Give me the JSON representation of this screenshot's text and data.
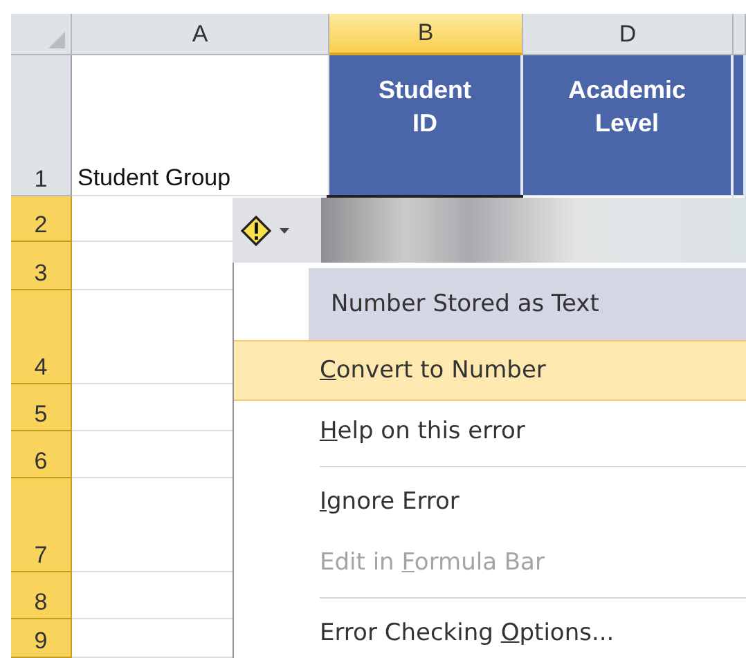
{
  "columns": [
    {
      "label": "A",
      "selected": false
    },
    {
      "label": "B",
      "selected": true
    },
    {
      "label": "D",
      "selected": false
    }
  ],
  "header_row": {
    "number": "1",
    "cells": [
      {
        "text": "Student Group",
        "kind": "plain"
      },
      {
        "text": "Student ID",
        "kind": "header"
      },
      {
        "text": "Academic Level",
        "kind": "header"
      }
    ]
  },
  "rows": [
    {
      "number": "2",
      "selected": true
    },
    {
      "number": "3",
      "selected": true
    },
    {
      "number": "4",
      "selected": true
    },
    {
      "number": "5",
      "selected": true
    },
    {
      "number": "6",
      "selected": true
    },
    {
      "number": "7",
      "selected": true
    },
    {
      "number": "8",
      "selected": true
    },
    {
      "number": "9",
      "selected": true
    }
  ],
  "error_menu": {
    "title": "Number Stored as Text",
    "items": [
      {
        "label_parts": [
          {
            "text": "C",
            "underlined": true
          },
          {
            "text": "onvert to Number",
            "underlined": false
          }
        ],
        "selected": true,
        "disabled": false,
        "separator_after": false
      },
      {
        "label_parts": [
          {
            "text": "H",
            "underlined": true
          },
          {
            "text": "elp on this error",
            "underlined": false
          }
        ],
        "selected": false,
        "disabled": false,
        "separator_after": true
      },
      {
        "label_parts": [
          {
            "text": "I",
            "underlined": true
          },
          {
            "text": "gnore Error",
            "underlined": false
          }
        ],
        "selected": false,
        "disabled": false,
        "separator_after": false
      },
      {
        "label_parts": [
          {
            "text": "Edit in ",
            "underlined": false
          },
          {
            "text": "F",
            "underlined": true
          },
          {
            "text": "ormula Bar",
            "underlined": false
          }
        ],
        "selected": false,
        "disabled": true,
        "separator_after": true
      },
      {
        "label_parts": [
          {
            "text": "Error Checking ",
            "underlined": false
          },
          {
            "text": "O",
            "underlined": true
          },
          {
            "text": "ptions...",
            "underlined": false
          }
        ],
        "selected": false,
        "disabled": false,
        "separator_after": false
      }
    ]
  }
}
